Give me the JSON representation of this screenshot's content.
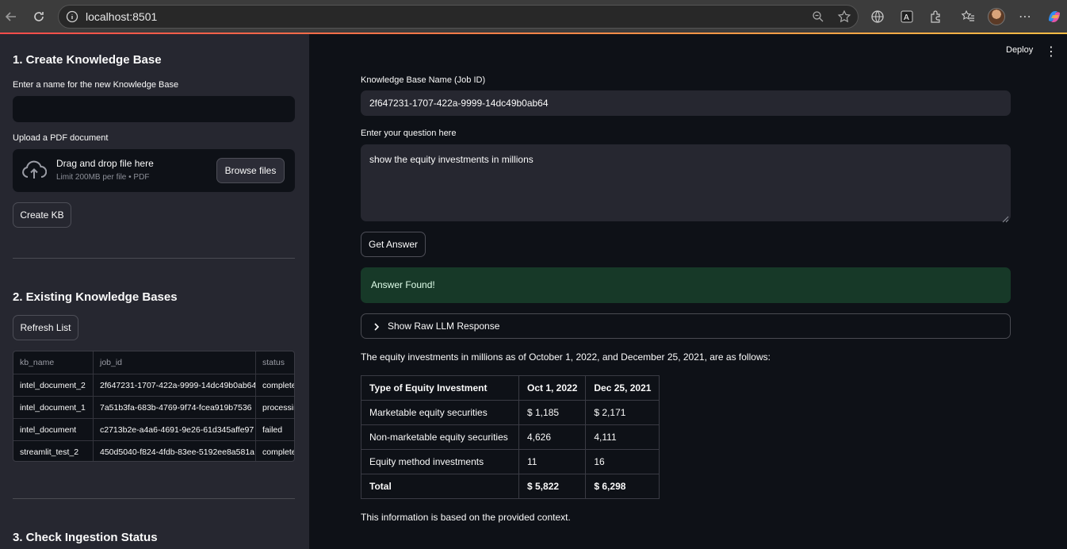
{
  "browser": {
    "url": "localhost:8501"
  },
  "sidebar": {
    "section1_title": "1. Create Knowledge Base",
    "kb_name_label": "Enter a name for the new Knowledge Base",
    "kb_name_value": "",
    "upload_label": "Upload a PDF document",
    "upload_main": "Drag and drop file here",
    "upload_sub": "Limit 200MB per file • PDF",
    "browse_button": "Browse files",
    "create_button": "Create KB",
    "section2_title": "2. Existing Knowledge Bases",
    "refresh_button": "Refresh List",
    "table": {
      "headers": [
        "kb_name",
        "job_id",
        "status"
      ],
      "rows": [
        [
          "intel_document_2",
          "2f647231-1707-422a-9999-14dc49b0ab64",
          "completed"
        ],
        [
          "intel_document_1",
          "7a51b3fa-683b-4769-9f74-fcea919b7536",
          "processing"
        ],
        [
          "intel_document",
          "c2713b2e-a4a6-4691-9e26-61d345affe97",
          "failed"
        ],
        [
          "streamlit_test_2",
          "450d5040-f824-4fdb-83ee-5192ee8a581a",
          "completed"
        ]
      ]
    },
    "section3_title": "3. Check Ingestion Status"
  },
  "header": {
    "deploy": "Deploy",
    "menu": "⋮"
  },
  "main": {
    "kb_label": "Knowledge Base Name (Job ID)",
    "kb_value": "2f647231-1707-422a-9999-14dc49b0ab64",
    "question_label": "Enter your question here",
    "question_value": "show the equity investments in millions",
    "get_answer_button": "Get Answer",
    "success_message": "Answer Found!",
    "expander_label": "Show Raw LLM Response",
    "answer_intro": "The equity investments in millions as of October 1, 2022, and December 25, 2021, are as follows:",
    "table": {
      "headers": [
        "Type of Equity Investment",
        "Oct 1, 2022",
        "Dec 25, 2021"
      ],
      "rows": [
        [
          "Marketable equity securities",
          "$ 1,185",
          "$ 2,171"
        ],
        [
          "Non-marketable equity securities",
          "4,626",
          "4,111"
        ],
        [
          "Equity method investments",
          "11",
          "16"
        ]
      ],
      "total": [
        "Total",
        "$ 5,822",
        "$ 6,298"
      ]
    },
    "answer_outro": "This information is based on the provided context."
  }
}
